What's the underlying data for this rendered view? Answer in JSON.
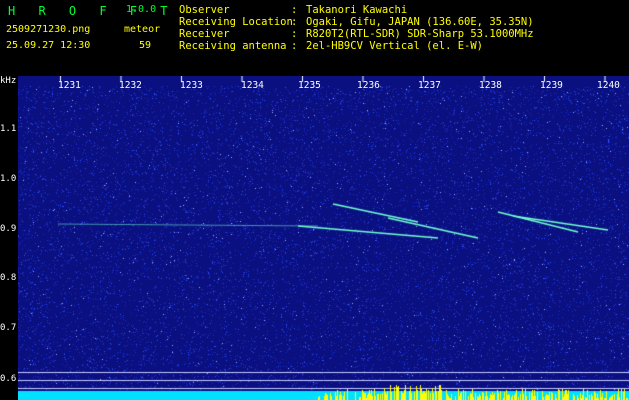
{
  "header": {
    "app_name": "H R O F F T",
    "version": "1.0.0",
    "filename": "2509271230.png",
    "datetime": "25.09.27 12:30",
    "meteor_label": "meteor",
    "meteor_count": "59",
    "info_labels": [
      "Observer",
      "Receiving Location",
      "Receiver",
      "Receiving antenna"
    ],
    "info_colons": [
      ":",
      ":",
      ":",
      ":"
    ],
    "info_values": [
      "Takanori Kawachi",
      "Ogaki, Gifu, JAPAN (136.60E, 35.35N)",
      "R820T2(RTL-SDR) SDR-Sharp 53.1000MHz",
      "2el-HB9CV Vertical (el. E-W)"
    ]
  },
  "axes": {
    "y_unit": "kHz",
    "y_ticks": [
      "1.1",
      "1.0",
      "0.9",
      "0.8",
      "0.7",
      "0.6"
    ],
    "x_ticks": [
      "1231",
      "1232",
      "1233",
      "1234",
      "1235",
      "1236",
      "1237",
      "1238",
      "1239",
      "1240"
    ]
  },
  "colors": {
    "background": "#0a1080",
    "noise": "#3050ff",
    "trail": "#70ffd0",
    "bar_cyan": "#00e0ff",
    "bar_yellow": "#ffff00",
    "label_green": "#00ff30",
    "label_yellow": "#ffff00"
  }
}
